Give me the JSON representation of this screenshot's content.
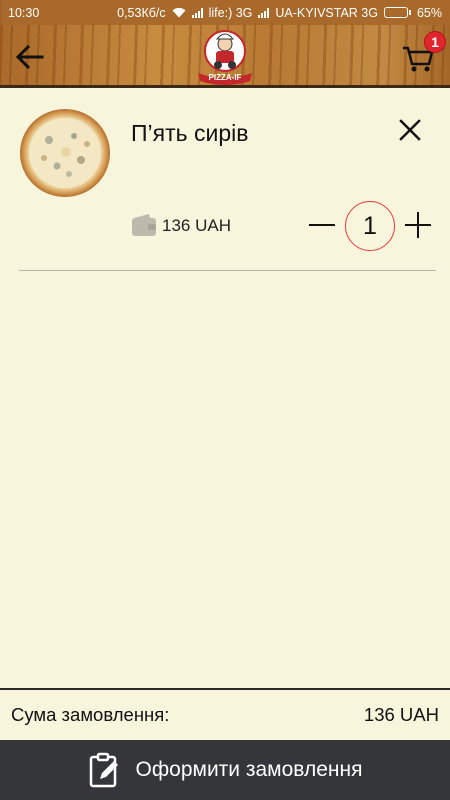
{
  "status_bar": {
    "time": "10:30",
    "speed": "0,53Кб/с",
    "carrier1": "life:) 3G",
    "carrier2": "UA-KYIVSTAR 3G",
    "battery": "65%",
    "battery_level": 0.65
  },
  "app_bar": {
    "back_icon": "arrow-left-icon",
    "logo_text": "PIZZA-IF",
    "cart_icon": "cart-icon",
    "cart_count": "1"
  },
  "cart": {
    "items": [
      {
        "name": "П’ять сирів",
        "price": "136 UAH",
        "quantity": "1",
        "image": "pizza-photo"
      }
    ]
  },
  "summary": {
    "label": "Сума замовлення:",
    "total": "136 UAH"
  },
  "checkout": {
    "label": "Оформити замовлення",
    "icon": "clipboard-edit-icon"
  },
  "colors": {
    "background": "#f8f5dd",
    "checkout_bar": "#35363a",
    "badge": "#e1252d",
    "qty_ring": "#e33b3b"
  }
}
